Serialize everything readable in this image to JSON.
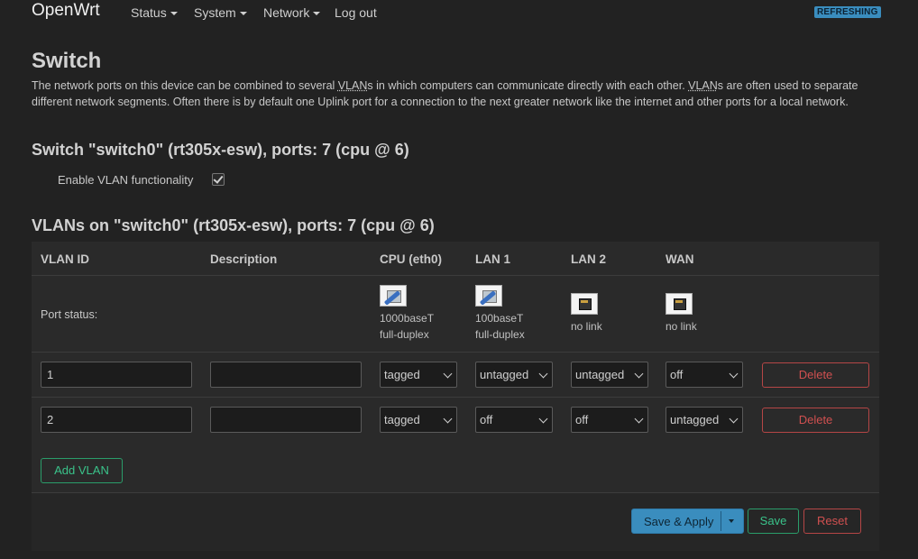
{
  "header": {
    "brand": "OpenWrt",
    "menu": [
      {
        "label": "Status",
        "dropdown": true
      },
      {
        "label": "System",
        "dropdown": true
      },
      {
        "label": "Network",
        "dropdown": true
      },
      {
        "label": "Log out",
        "dropdown": false
      }
    ],
    "status_badge": "REFRESHING"
  },
  "page": {
    "title": "Switch",
    "description": {
      "p1": "The network ports on this device can be combined to several ",
      "abbr1": "VLAN",
      "p2": "s in which computers can communicate directly with each other. ",
      "abbr2": "VLAN",
      "p3": "s are often used to separate different network segments. Often there is by default one Uplink port for a connection to the next greater network like the internet and other ports for a local network."
    }
  },
  "switch_section": {
    "title": "Switch \"switch0\" (rt305x-esw), ports: 7 (cpu @ 6)",
    "enable_vlan_label": "Enable VLAN functionality",
    "enable_vlan_checked": true
  },
  "vlan_section": {
    "title": "VLANs on \"switch0\" (rt305x-esw), ports: 7 (cpu @ 6)",
    "columns": [
      "VLAN ID",
      "Description",
      "CPU (eth0)",
      "LAN 1",
      "LAN 2",
      "WAN"
    ],
    "port_status_label": "Port status:",
    "port_status": [
      {
        "icon": "port-up-icon",
        "line1": "1000baseT",
        "line2": "full-duplex"
      },
      {
        "icon": "port-up-icon",
        "line1": "100baseT",
        "line2": "full-duplex"
      },
      {
        "icon": "port-down-icon",
        "line1": "no link",
        "line2": ""
      },
      {
        "icon": "port-down-icon",
        "line1": "no link",
        "line2": ""
      }
    ],
    "rows": [
      {
        "vlan_id": "1",
        "description": "",
        "ports": [
          "tagged",
          "untagged",
          "untagged",
          "off"
        ],
        "delete_label": "Delete"
      },
      {
        "vlan_id": "2",
        "description": "",
        "ports": [
          "tagged",
          "off",
          "off",
          "untagged"
        ],
        "delete_label": "Delete"
      }
    ],
    "add_label": "Add VLAN"
  },
  "footer": {
    "save_apply_label": "Save & Apply",
    "save_label": "Save",
    "reset_label": "Reset"
  },
  "colors": {
    "background": "#222222",
    "panel": "#2a2a2a",
    "primary": "#3a8dbe",
    "positive": "#2a9d6a",
    "negative": "#b54646"
  }
}
